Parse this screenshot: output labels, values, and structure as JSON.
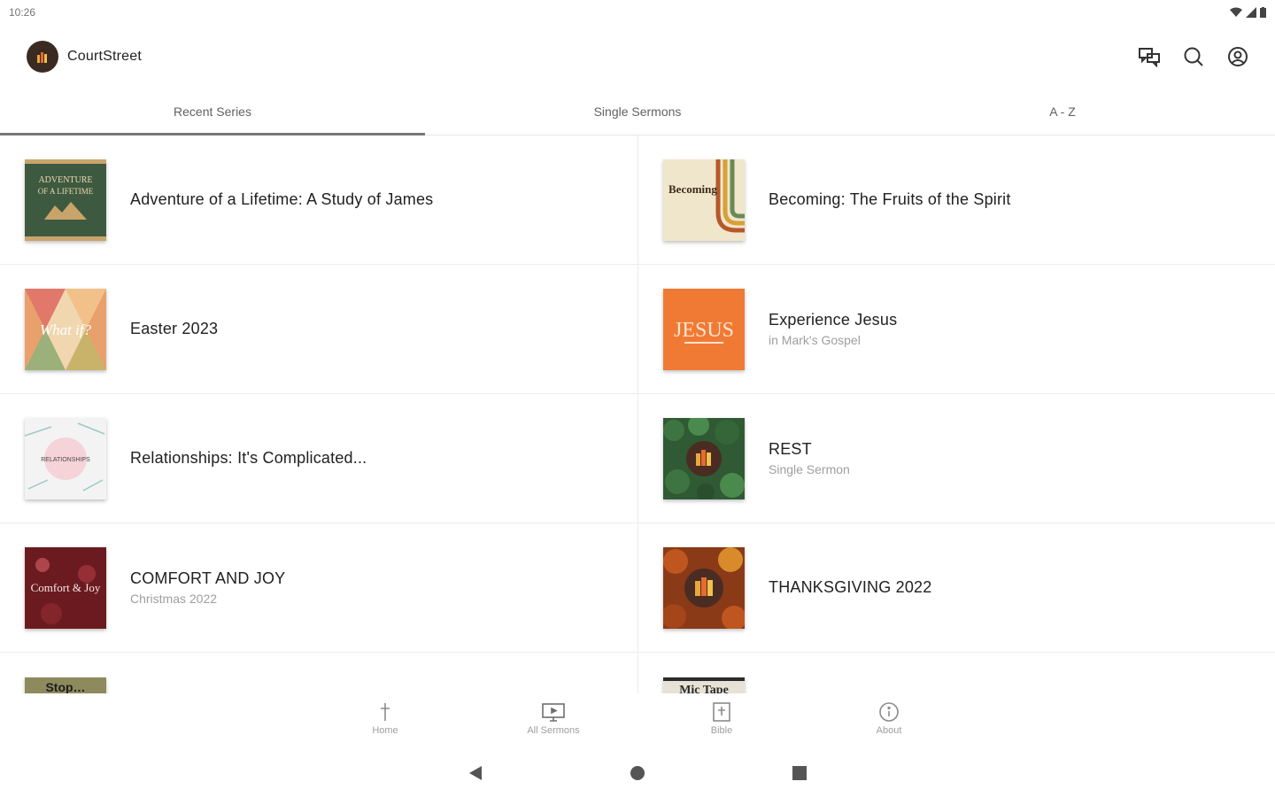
{
  "status_bar": {
    "time": "10:26"
  },
  "app_bar": {
    "title": "CourtStreet",
    "icons": [
      "chat-icon",
      "search-icon",
      "account-icon"
    ]
  },
  "tabs": [
    {
      "label": "Recent Series",
      "active": true
    },
    {
      "label": "Single Sermons",
      "active": false
    },
    {
      "label": "A - Z",
      "active": false
    }
  ],
  "series": [
    {
      "title": "Adventure of a Lifetime: A Study of James",
      "subtitle": "",
      "thumb_text": "ADVENTURE OF A LIFETIME",
      "thumb_colors": [
        "#3d5a40",
        "#c9a46a"
      ]
    },
    {
      "title": "Becoming: The Fruits of the Spirit",
      "subtitle": "",
      "thumb_text": "Becoming",
      "thumb_colors": [
        "#efe6cc",
        "#b5582a"
      ]
    },
    {
      "title": "Easter  2023",
      "subtitle": "",
      "thumb_text": "What if?",
      "thumb_colors": [
        "#e8a06d",
        "#9bb07a"
      ]
    },
    {
      "title": "Experience Jesus",
      "subtitle": "in Mark's Gospel",
      "thumb_text": "JESUS",
      "thumb_colors": [
        "#f07a34",
        "#ffffff"
      ]
    },
    {
      "title": "Relationships: It's Complicated...",
      "subtitle": "",
      "thumb_text": "RELATIONSHIPS",
      "thumb_colors": [
        "#f3f3f3",
        "#e9a7b3"
      ]
    },
    {
      "title": "REST",
      "subtitle": "Single Sermon",
      "thumb_text": "",
      "thumb_colors": [
        "#2f5a33",
        "#4a2c22"
      ]
    },
    {
      "title": "COMFORT AND JOY",
      "subtitle": "Christmas 2022",
      "thumb_text": "Comfort & Joy",
      "thumb_colors": [
        "#6b1b1f",
        "#c9575d"
      ]
    },
    {
      "title": "THANKSGIVING 2022",
      "subtitle": "",
      "thumb_text": "",
      "thumb_colors": [
        "#8a3a17",
        "#4a2c22"
      ]
    },
    {
      "title": "",
      "subtitle": "",
      "thumb_text": "Stop…",
      "thumb_colors": [
        "#2a2d2a",
        "#8d8a5d"
      ]
    },
    {
      "title": "",
      "subtitle": "",
      "thumb_text": "Mic Tape",
      "thumb_colors": [
        "#e7e2d5",
        "#2b2b2b"
      ]
    }
  ],
  "bottom_nav": [
    {
      "label": "Home",
      "icon": "cross-icon"
    },
    {
      "label": "All Sermons",
      "icon": "monitor-icon"
    },
    {
      "label": "Bible",
      "icon": "bible-icon"
    },
    {
      "label": "About",
      "icon": "info-icon"
    }
  ],
  "system_nav": [
    "back-icon",
    "home-circle-icon",
    "recents-icon"
  ]
}
